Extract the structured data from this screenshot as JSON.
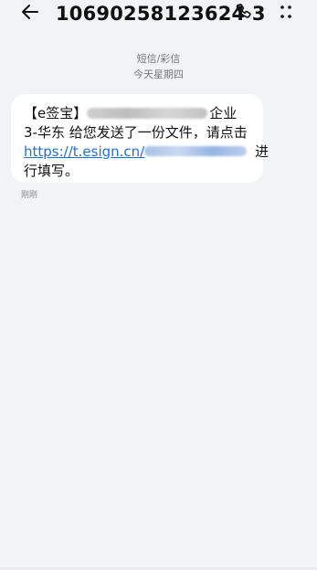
{
  "header": {
    "title": "10690258123624 3",
    "back_icon": "back-arrow-icon",
    "call_icon": "phone-icon",
    "more_icon": "more-options-icon"
  },
  "conversation": {
    "channel": "短信/彩信",
    "day": "今天星期四"
  },
  "message": {
    "line1_prefix": "【e签宝】",
    "line1_suffix": "企业",
    "line2": "3-华东 给您发送了一份文件，请点击",
    "link_prefix": "https://t.esign.cn/",
    "line3_suffix": " 进",
    "line4": "行填写。",
    "time": "刚刚"
  }
}
